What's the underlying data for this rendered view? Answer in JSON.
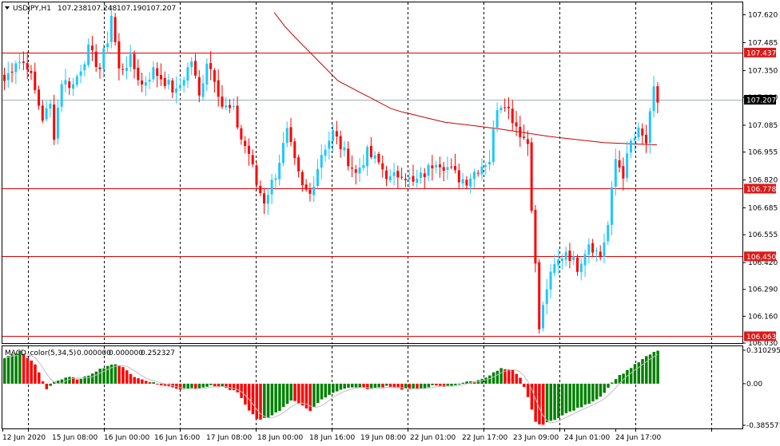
{
  "symbol_info": {
    "symbol": "USDJPY,H1",
    "open": "107.238",
    "high": "107.248",
    "low": "107.190",
    "close": "107.207"
  },
  "indicator_info": {
    "name": "MACD_color(5,34,5)",
    "v1": "0.000000",
    "v2": "0.000000",
    "v3": "0.252327"
  },
  "price_axis": {
    "ticks": [
      "107.620",
      "107.485",
      "107.350",
      "107.220",
      "107.085",
      "106.955",
      "106.820",
      "106.685",
      "106.555",
      "106.420",
      "106.290",
      "106.160",
      "106.030"
    ]
  },
  "macd_axis": {
    "ticks": [
      "0.310295",
      "0.00",
      "-0.385571"
    ]
  },
  "time_axis": {
    "labels": [
      "12 Jun 2020",
      "15 Jun 08:00",
      "16 Jun 00:00",
      "16 Jun 16:00",
      "17 Jun 08:00",
      "18 Jun 00:00",
      "18 Jun 16:00",
      "19 Jun 08:00",
      "22 Jun 01:00",
      "22 Jun 17:00",
      "23 Jun 09:00",
      "24 Jun 01:00",
      "24 Jun 17:00"
    ]
  },
  "horizontal_lines": [
    {
      "price": "107.437"
    },
    {
      "price": "106.778"
    },
    {
      "price": "106.450"
    },
    {
      "price": "106.063"
    }
  ],
  "current_price": "107.207",
  "colors": {
    "bull": "#1ec8ff",
    "bear": "#ff0000",
    "hline": "#dd0000",
    "ma": "#cc0000",
    "current_line": "#9fb3ba",
    "hist_pos": "#008000",
    "hist_neg": "#ff0000",
    "signal": "#c0c0c0",
    "grid": "#000000",
    "tag_bg": "#dd1a1a",
    "current_tag_bg": "#000000"
  },
  "chart_data": {
    "type": "candlestick",
    "symbol": "USDJPY",
    "timeframe": "H1",
    "ylim": [
      106.03,
      107.68
    ],
    "anchor_closes": [
      [
        0,
        107.3
      ],
      [
        3,
        107.4
      ],
      [
        6,
        107.38
      ],
      [
        8,
        107.25
      ],
      [
        10,
        107.12
      ],
      [
        12,
        107.18
      ],
      [
        13,
        107.04
      ],
      [
        15,
        107.3
      ],
      [
        18,
        107.28
      ],
      [
        22,
        107.45
      ],
      [
        25,
        107.36
      ],
      [
        27,
        107.5
      ],
      [
        28,
        107.62
      ],
      [
        30,
        107.35
      ],
      [
        33,
        107.4
      ],
      [
        36,
        107.28
      ],
      [
        39,
        107.35
      ],
      [
        42,
        107.3
      ],
      [
        45,
        107.24
      ],
      [
        49,
        107.4
      ],
      [
        51,
        107.22
      ],
      [
        53,
        107.4
      ],
      [
        55,
        107.32
      ],
      [
        57,
        107.18
      ],
      [
        60,
        107.15
      ],
      [
        62,
        107.02
      ],
      [
        64,
        106.95
      ],
      [
        66,
        106.8
      ],
      [
        68,
        106.72
      ],
      [
        71,
        106.85
      ],
      [
        74,
        107.05
      ],
      [
        76,
        106.9
      ],
      [
        78,
        106.78
      ],
      [
        80,
        106.75
      ],
      [
        83,
        106.95
      ],
      [
        86,
        107.05
      ],
      [
        89,
        106.95
      ],
      [
        92,
        106.85
      ],
      [
        95,
        106.95
      ],
      [
        98,
        106.9
      ],
      [
        101,
        106.82
      ],
      [
        104,
        106.86
      ],
      [
        107,
        106.8
      ],
      [
        110,
        106.85
      ],
      [
        113,
        106.92
      ],
      [
        116,
        106.88
      ],
      [
        119,
        106.83
      ],
      [
        121,
        106.82
      ],
      [
        124,
        106.88
      ],
      [
        127,
        106.92
      ],
      [
        129,
        107.18
      ],
      [
        131,
        107.2
      ],
      [
        133,
        107.12
      ],
      [
        135,
        107.05
      ],
      [
        137,
        107.0
      ],
      [
        138,
        106.7
      ],
      [
        139,
        106.4
      ],
      [
        140,
        106.1
      ],
      [
        142,
        106.3
      ],
      [
        144,
        106.4
      ],
      [
        147,
        106.48
      ],
      [
        150,
        106.4
      ],
      [
        153,
        106.52
      ],
      [
        156,
        106.45
      ],
      [
        158,
        106.6
      ],
      [
        160,
        106.92
      ],
      [
        162,
        106.85
      ],
      [
        164,
        107.0
      ],
      [
        166,
        107.05
      ],
      [
        168,
        107.0
      ],
      [
        170,
        107.25
      ],
      [
        171,
        107.2
      ]
    ],
    "moving_average": [
      [
        107.9,
        0
      ],
      [
        107.55,
        0.13
      ],
      [
        107.3,
        0.25
      ],
      [
        107.16,
        0.38
      ],
      [
        107.1,
        0.5
      ],
      [
        107.07,
        0.62
      ],
      [
        107.03,
        0.75
      ],
      [
        107.0,
        0.88
      ],
      [
        106.99,
        1.0
      ]
    ],
    "macd_histogram_range": [
      -0.385571,
      0.310295
    ],
    "macd_anchor_values": [
      [
        0,
        0.24
      ],
      [
        4,
        0.3
      ],
      [
        8,
        0.18
      ],
      [
        11,
        -0.05
      ],
      [
        13,
        0.02
      ],
      [
        17,
        0.06
      ],
      [
        20,
        0.04
      ],
      [
        24,
        0.12
      ],
      [
        28,
        0.18
      ],
      [
        31,
        0.16
      ],
      [
        34,
        0.06
      ],
      [
        38,
        0.02
      ],
      [
        42,
        -0.02
      ],
      [
        46,
        -0.05
      ],
      [
        50,
        -0.04
      ],
      [
        54,
        -0.02
      ],
      [
        57,
        -0.03
      ],
      [
        61,
        -0.08
      ],
      [
        63,
        -0.2
      ],
      [
        66,
        -0.33
      ],
      [
        69,
        -0.32
      ],
      [
        72,
        -0.25
      ],
      [
        75,
        -0.15
      ],
      [
        78,
        -0.2
      ],
      [
        80,
        -0.25
      ],
      [
        84,
        -0.12
      ],
      [
        88,
        -0.05
      ],
      [
        92,
        -0.03
      ],
      [
        96,
        -0.05
      ],
      [
        100,
        -0.02
      ],
      [
        104,
        -0.05
      ],
      [
        108,
        -0.05
      ],
      [
        112,
        -0.02
      ],
      [
        116,
        -0.03
      ],
      [
        120,
        0.01
      ],
      [
        124,
        0.03
      ],
      [
        127,
        0.08
      ],
      [
        130,
        0.14
      ],
      [
        133,
        0.12
      ],
      [
        135,
        0.05
      ],
      [
        137,
        -0.12
      ],
      [
        139,
        -0.36
      ],
      [
        141,
        -0.38
      ],
      [
        144,
        -0.33
      ],
      [
        148,
        -0.26
      ],
      [
        152,
        -0.2
      ],
      [
        156,
        -0.12
      ],
      [
        160,
        0.05
      ],
      [
        164,
        0.15
      ],
      [
        168,
        0.25
      ],
      [
        171,
        0.31
      ]
    ]
  }
}
